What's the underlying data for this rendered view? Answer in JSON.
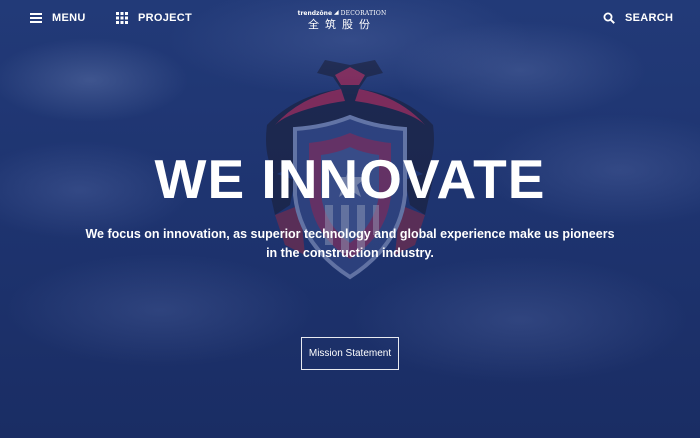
{
  "header": {
    "menu_label": "MENU",
    "project_label": "PROJECT",
    "search_label": "SEARCH",
    "logo": {
      "brand": "trendzōne",
      "sub": "DECORATION",
      "cn": "全筑股份"
    }
  },
  "hero": {
    "headline": "WE INNOVATE",
    "subtext": "We focus on innovation, as superior technology and global experience make us pioneers in the construction industry.",
    "cta_label": "Mission Statement"
  },
  "icons": {
    "menu": "hamburger-icon",
    "project": "grid-icon",
    "search": "search-icon",
    "emblem": "eagle-shield-emblem"
  },
  "colors": {
    "background": "#1e3470",
    "text": "#ffffff",
    "emblem_red": "#c8244a"
  }
}
